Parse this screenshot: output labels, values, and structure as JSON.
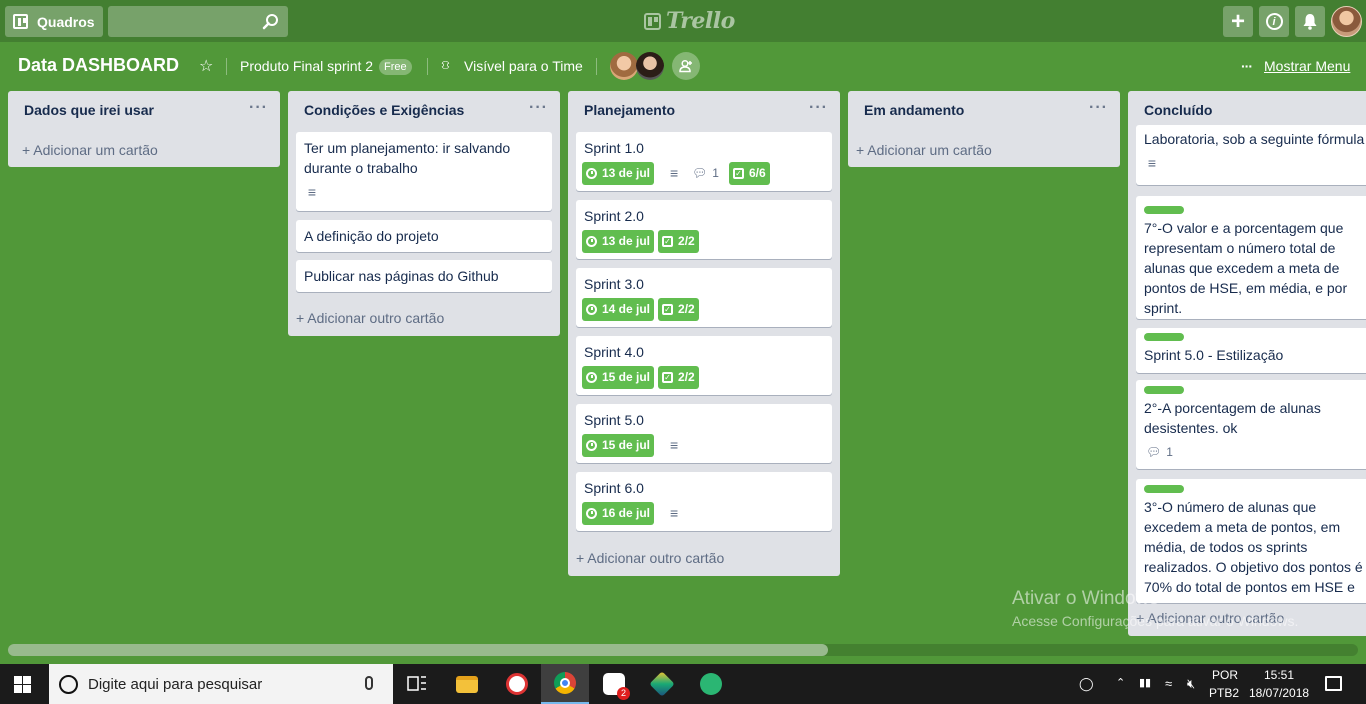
{
  "header": {
    "boards_label": "Quadros",
    "search_placeholder": "",
    "logo_text": "Trello"
  },
  "board": {
    "title": "Data DASHBOARD",
    "team": "Produto Final sprint 2",
    "plan_badge": "Free",
    "visibility": "Visível para o Time",
    "show_menu": "Mostrar Menu",
    "menu_dots": "···"
  },
  "lists": [
    {
      "title": "Dados que irei usar",
      "add_label": "+ Adicionar um cartão"
    },
    {
      "title": "Condições e Exigências",
      "cards": [
        {
          "title": "Ter um planejamento: ir salvando durante o trabalho"
        },
        {
          "title": "A definição do projeto"
        },
        {
          "title": "Publicar nas páginas do Github"
        }
      ],
      "add_label": "+ Adicionar outro cartão"
    },
    {
      "title": "Planejamento",
      "cards": [
        {
          "title": "Sprint 1.0",
          "due": "13 de jul",
          "comments": "1",
          "checklist": "6/6"
        },
        {
          "title": "Sprint 2.0",
          "due": "13 de jul",
          "checklist": "2/2"
        },
        {
          "title": "Sprint 3.0",
          "due": "14 de jul",
          "checklist": "2/2"
        },
        {
          "title": "Sprint 4.0",
          "due": "15 de jul",
          "checklist": "2/2"
        },
        {
          "title": "Sprint 5.0",
          "due": "15 de jul"
        },
        {
          "title": "Sprint 6.0",
          "due": "16 de jul"
        }
      ],
      "add_label": "+ Adicionar outro cartão"
    },
    {
      "title": "Em andamento",
      "add_label": "+ Adicionar um cartão"
    },
    {
      "title": "Concluído",
      "cards": [
        {
          "title": "Laboratoria, sob a seguinte fórmula"
        },
        {
          "title": "7°-O valor e a porcentagem que representam o número total de alunas que excedem a meta de pontos de HSE, em média, e por sprint."
        },
        {
          "title": "Sprint 5.0 - Estilização"
        },
        {
          "title": "2°-A porcentagem de alunas desistentes. ok",
          "comments": "1"
        },
        {
          "title": "3°-O número de alunas que excedem a meta de pontos, em média, de todos os sprints realizados. O objetivo dos pontos é 70% do total de pontos em HSE e"
        }
      ],
      "add_label": "+ Adicionar outro cartão"
    }
  ],
  "watermark": {
    "line1": "Ativar o Windows",
    "line2": "Acesse Configurações para ativar o Windows."
  },
  "taskbar": {
    "search_text": "Digite aqui para pesquisar",
    "lang1": "POR",
    "lang2": "PTB2",
    "time": "15:51",
    "date": "18/07/2018",
    "badge_count": "2"
  }
}
